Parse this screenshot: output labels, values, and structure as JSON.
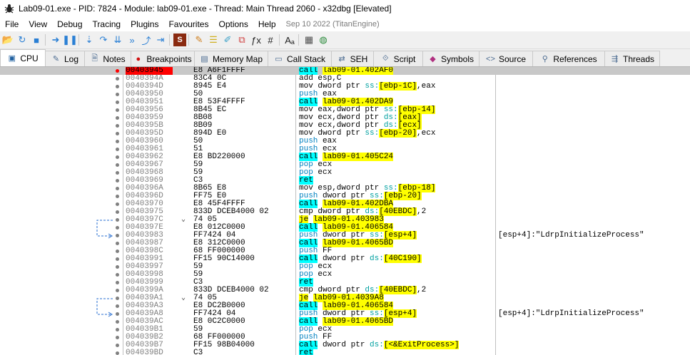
{
  "window": {
    "title": "Lab09-01.exe - PID: 7824 - Module: lab09-01.exe - Thread: Main Thread 2060 - x32dbg [Elevated]"
  },
  "menu": {
    "items": [
      "File",
      "View",
      "Debug",
      "Tracing",
      "Plugins",
      "Favourites",
      "Options",
      "Help"
    ],
    "date": "Sep 10 2022 (TitanEngine)"
  },
  "toolbar": {
    "icons": [
      "open-icon",
      "restart-icon",
      "stop-icon",
      "run-icon",
      "pause-icon",
      "step-into-icon",
      "step-over-icon",
      "animate-into-icon",
      "animate-over-icon",
      "execute-till-return-icon",
      "run-to-user-code-icon",
      "scylla-icon",
      "patch-icon",
      "comment-icon",
      "bookmark-icon",
      "label-icon",
      "function-icon",
      "hash-icon",
      "font-icon",
      "calculator-icon",
      "globe-icon"
    ]
  },
  "tabs": [
    {
      "label": "CPU",
      "icon": "cpu-icon",
      "active": true
    },
    {
      "label": "Log",
      "icon": "log-icon"
    },
    {
      "label": "Notes",
      "icon": "notes-icon"
    },
    {
      "label": "Breakpoints",
      "icon": "breakpoint-icon"
    },
    {
      "label": "Memory Map",
      "icon": "memory-map-icon"
    },
    {
      "label": "Call Stack",
      "icon": "call-stack-icon"
    },
    {
      "label": "SEH",
      "icon": "seh-icon"
    },
    {
      "label": "Script",
      "icon": "script-icon"
    },
    {
      "label": "Symbols",
      "icon": "symbols-icon"
    },
    {
      "label": "Source",
      "icon": "source-icon"
    },
    {
      "label": "References",
      "icon": "references-icon"
    },
    {
      "label": "Threads",
      "icon": "threads-icon"
    }
  ],
  "disasm": {
    "rows": [
      {
        "addr": "00403945",
        "bytes": "E8 A6F1FFFF",
        "instr": "call lab09-01.402AF0",
        "bp": true,
        "current": true
      },
      {
        "addr": "0040394A",
        "bytes": "83C4 0C",
        "instr": "add esp,C"
      },
      {
        "addr": "0040394D",
        "bytes": "8945 E4",
        "instr": "mov dword ptr ss:[ebp-1C],eax"
      },
      {
        "addr": "00403950",
        "bytes": "50",
        "instr": "push eax"
      },
      {
        "addr": "00403951",
        "bytes": "E8 53F4FFFF",
        "instr": "call lab09-01.402DA9"
      },
      {
        "addr": "00403956",
        "bytes": "8B45 EC",
        "instr": "mov eax,dword ptr ss:[ebp-14]"
      },
      {
        "addr": "00403959",
        "bytes": "8B08",
        "instr": "mov ecx,dword ptr ds:[eax]"
      },
      {
        "addr": "0040395B",
        "bytes": "8B09",
        "instr": "mov ecx,dword ptr ds:[ecx]"
      },
      {
        "addr": "0040395D",
        "bytes": "894D E0",
        "instr": "mov dword ptr ss:[ebp-20],ecx"
      },
      {
        "addr": "00403960",
        "bytes": "50",
        "instr": "push eax"
      },
      {
        "addr": "00403961",
        "bytes": "51",
        "instr": "push ecx"
      },
      {
        "addr": "00403962",
        "bytes": "E8 BD220000",
        "instr": "call lab09-01.405C24"
      },
      {
        "addr": "00403967",
        "bytes": "59",
        "instr": "pop ecx"
      },
      {
        "addr": "00403968",
        "bytes": "59",
        "instr": "pop ecx"
      },
      {
        "addr": "00403969",
        "bytes": "C3",
        "instr": "ret"
      },
      {
        "addr": "0040396A",
        "bytes": "8B65 E8",
        "instr": "mov esp,dword ptr ss:[ebp-18]"
      },
      {
        "addr": "0040396D",
        "bytes": "FF75 E0",
        "instr": "push dword ptr ss:[ebp-20]"
      },
      {
        "addr": "00403970",
        "bytes": "E8 45F4FFFF",
        "instr": "call lab09-01.402DBA"
      },
      {
        "addr": "00403975",
        "bytes": "833D DCEB4000 02",
        "instr": "cmp dword ptr ds:[40EBDC],2"
      },
      {
        "addr": "0040397C",
        "bytes": "74 05",
        "instr": "je lab09-01.403983",
        "jump": true
      },
      {
        "addr": "0040397E",
        "bytes": "E8 012C0000",
        "instr": "call lab09-01.406584"
      },
      {
        "addr": "00403983",
        "bytes": "FF7424 04",
        "instr": "push dword ptr ss:[esp+4]",
        "comment": "[esp+4]:\"LdrpInitializeProcess\""
      },
      {
        "addr": "00403987",
        "bytes": "E8 312C0000",
        "instr": "call lab09-01.4065BD"
      },
      {
        "addr": "0040398C",
        "bytes": "68 FF000000",
        "instr": "push FF"
      },
      {
        "addr": "00403991",
        "bytes": "FF15 90C14000",
        "instr": "call dword ptr ds:[40C190]"
      },
      {
        "addr": "00403997",
        "bytes": "59",
        "instr": "pop ecx"
      },
      {
        "addr": "00403998",
        "bytes": "59",
        "instr": "pop ecx"
      },
      {
        "addr": "00403999",
        "bytes": "C3",
        "instr": "ret"
      },
      {
        "addr": "0040399A",
        "bytes": "833D DCEB4000 02",
        "instr": "cmp dword ptr ds:[40EBDC],2"
      },
      {
        "addr": "004039A1",
        "bytes": "74 05",
        "instr": "je lab09-01.4039A8",
        "jump": true
      },
      {
        "addr": "004039A3",
        "bytes": "E8 DC2B0000",
        "instr": "call lab09-01.406584"
      },
      {
        "addr": "004039A8",
        "bytes": "FF7424 04",
        "instr": "push dword ptr ss:[esp+4]",
        "comment": "[esp+4]:\"LdrpInitializeProcess\""
      },
      {
        "addr": "004039AC",
        "bytes": "E8 0C2C0000",
        "instr": "call lab09-01.4065BD"
      },
      {
        "addr": "004039B1",
        "bytes": "59",
        "instr": "pop ecx"
      },
      {
        "addr": "004039B2",
        "bytes": "68 FF000000",
        "instr": "push FF"
      },
      {
        "addr": "004039B7",
        "bytes": "FF15 98B04000",
        "instr": "call dword ptr ds:[<&ExitProcess>]"
      },
      {
        "addr": "004039BD",
        "bytes": "C3",
        "instr": "ret"
      }
    ]
  }
}
